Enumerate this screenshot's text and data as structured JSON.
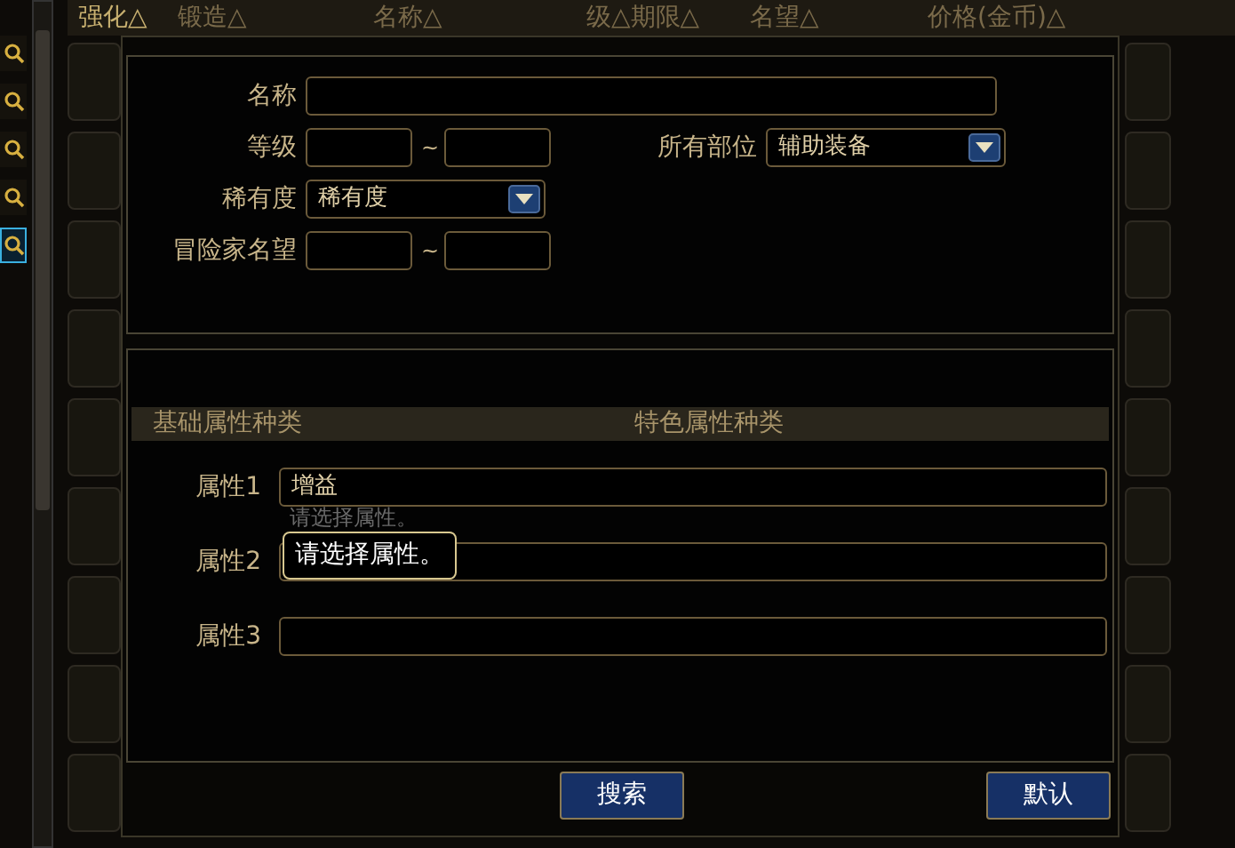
{
  "header_columns": [
    "强化△",
    "锻造△",
    "名称△",
    "级△期限△",
    "名望△",
    "价格(金币)△"
  ],
  "sidebar": {
    "icons": [
      {
        "selected": false
      },
      {
        "selected": false
      },
      {
        "selected": false
      },
      {
        "selected": false
      },
      {
        "selected": true
      }
    ]
  },
  "form": {
    "name": {
      "label": "名称"
    },
    "level": {
      "label": "等级",
      "separator": "~"
    },
    "slot": {
      "label": "所有部位",
      "value": "辅助装备"
    },
    "rarity": {
      "label": "稀有度",
      "value": "稀有度"
    },
    "reputation": {
      "label": "冒险家名望",
      "separator": "~"
    }
  },
  "attribute_tabs": [
    "基础属性种类",
    "特色属性种类"
  ],
  "attributes": [
    {
      "label": "属性1",
      "value": "增益",
      "hint": "请选择属性。"
    },
    {
      "label": "属性2"
    },
    {
      "label": "属性3"
    }
  ],
  "tooltip": "请选择属性。",
  "buttons": [
    "搜索",
    "默认"
  ]
}
